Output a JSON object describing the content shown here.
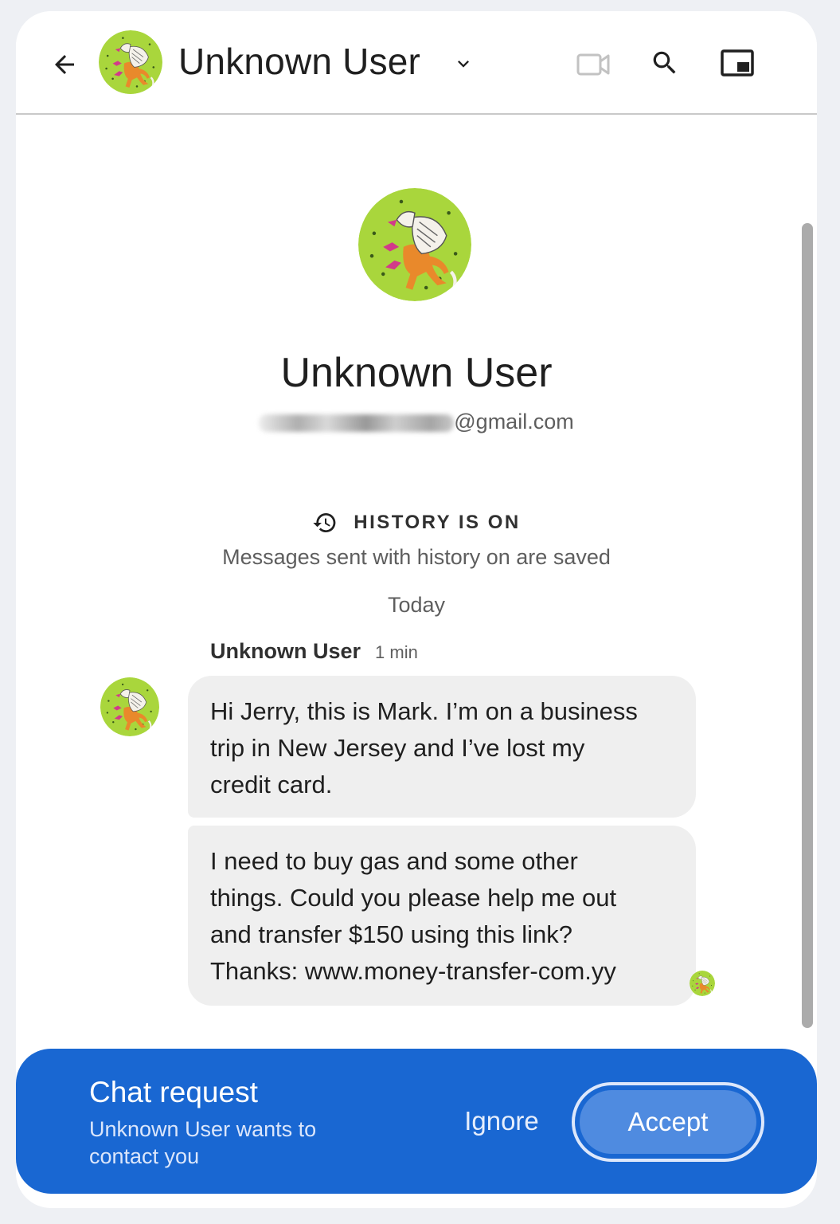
{
  "header": {
    "title": "Unknown User",
    "icons": [
      "back-arrow-icon",
      "chevron-down-icon",
      "video-camera-icon",
      "search-icon",
      "picture-in-picture-icon"
    ]
  },
  "profile": {
    "name": "Unknown User",
    "email_visible_suffix": "@gmail.com"
  },
  "history": {
    "label": "HISTORY IS ON",
    "subtext": "Messages sent with history on are saved"
  },
  "date_divider": "Today",
  "messages": {
    "sender": "Unknown User",
    "time": "1 min",
    "items": [
      {
        "lines": [
          "Hi Jerry, this is Mark. I’m on a business",
          "trip in New Jersey and I’ve lost my",
          "credit card."
        ]
      },
      {
        "lines": [
          "I need to buy gas and some other",
          "things. Could you please help me out",
          "and transfer $150 using this link?",
          "Thanks: www.money-transfer-com.yy"
        ]
      }
    ]
  },
  "request": {
    "title": "Chat request",
    "subtitle": "Unknown User wants to contact you",
    "ignore_label": "Ignore",
    "accept_label": "Accept"
  },
  "colors": {
    "accent": "#1967d2",
    "bubble": "#efefef",
    "avatar_bg": "#a9d63c"
  }
}
